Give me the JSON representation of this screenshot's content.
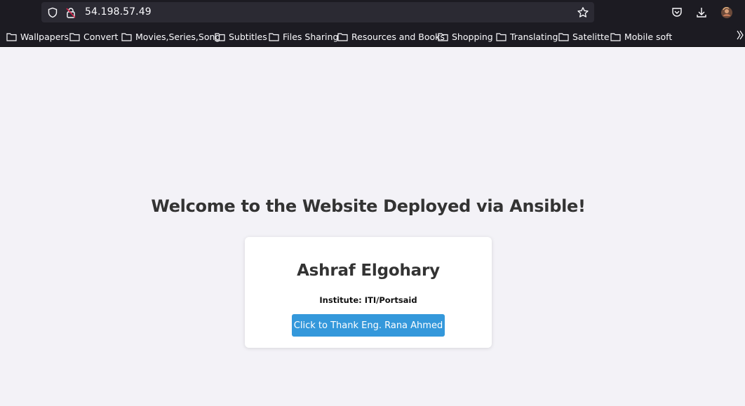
{
  "browser": {
    "url": "54.198.57.49",
    "bookmarks": [
      "Wallpapers",
      "Convert",
      "Movies,Series,Song",
      "Subtitles",
      "Files Sharing",
      "Resources and Books",
      "Shopping",
      "Translating",
      "Satelitte",
      "Mobile soft"
    ],
    "icons": {
      "shield": "tracking-protection-icon",
      "lock": "insecure-connection-icon",
      "star": "bookmark-star-icon",
      "pocket": "pocket-icon",
      "download": "download-icon",
      "avatar": "account-avatar-icon",
      "overflow": "bookmarks-overflow-icon"
    }
  },
  "page": {
    "heading": "Welcome to the Website Deployed via Ansible!",
    "card": {
      "name": "Ashraf Elgohary",
      "institute": "Institute: ITI/Portsaid",
      "button_label": "Click to Thank Eng. Rana Ahmed"
    }
  },
  "colors": {
    "chrome_bg": "#1c1b22",
    "urlbar_bg": "#2b2a33",
    "page_bg": "#f3f2f7",
    "button_bg": "#3498db",
    "heading_text": "#333333"
  }
}
